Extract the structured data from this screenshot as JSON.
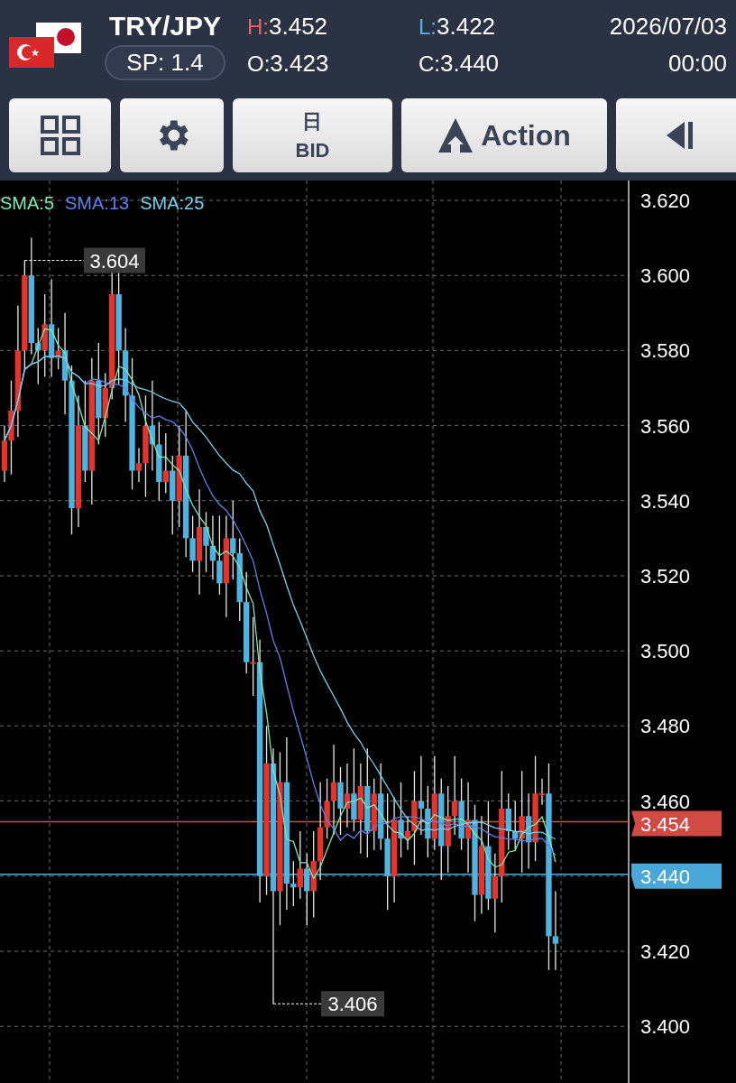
{
  "header": {
    "pair": "TRY/JPY",
    "spread": "SP: 1.4",
    "quotes": [
      {
        "kind": "high",
        "label": "H:",
        "value": "3.452"
      },
      {
        "kind": "low",
        "label": "L:",
        "value": "3.422"
      },
      {
        "kind": "open",
        "label": "O:",
        "value": "3.423"
      },
      {
        "kind": "close",
        "label": "C:",
        "value": "3.440"
      }
    ],
    "date": "2026/07/03",
    "time": "00:00"
  },
  "toolbar": [
    {
      "kind": "grid"
    },
    {
      "kind": "settings"
    },
    {
      "kind": "period",
      "top": "日",
      "bottom": "BID"
    },
    {
      "kind": "action",
      "label": "Action"
    },
    {
      "kind": "collapse"
    }
  ],
  "chart": {
    "indicators": [
      {
        "label": "SMA:5",
        "color": "#7ee8b4"
      },
      {
        "label": "SMA:13",
        "color": "#5f80e6"
      },
      {
        "label": "SMA:25",
        "color": "#7ccfe8"
      }
    ],
    "price_labels": [
      "3.620",
      "3.600",
      "3.580",
      "3.560",
      "3.540",
      "3.520",
      "3.500",
      "3.480",
      "3.460",
      "3.420",
      "3.400"
    ],
    "high_marker": "3.604",
    "low_marker": "3.406",
    "bid_tag": "3.454",
    "ask_tag": "3.440"
  }
}
